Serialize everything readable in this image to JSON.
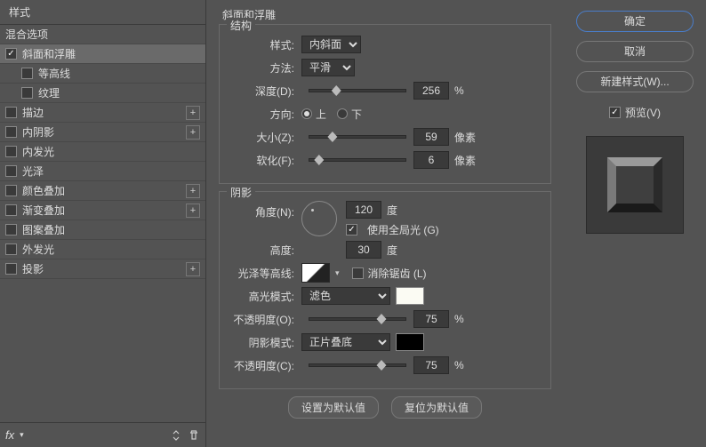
{
  "left": {
    "header": "样式",
    "blend_options": "混合选项",
    "items": [
      {
        "label": "斜面和浮雕",
        "checked": true,
        "selected": true,
        "has_add": false
      },
      {
        "label": "等高线",
        "checked": false,
        "sub": true
      },
      {
        "label": "纹理",
        "checked": false,
        "sub": true
      },
      {
        "label": "描边",
        "checked": false,
        "has_add": true
      },
      {
        "label": "内阴影",
        "checked": false,
        "has_add": true
      },
      {
        "label": "内发光",
        "checked": false
      },
      {
        "label": "光泽",
        "checked": false
      },
      {
        "label": "颜色叠加",
        "checked": false,
        "has_add": true
      },
      {
        "label": "渐变叠加",
        "checked": false,
        "has_add": true
      },
      {
        "label": "图案叠加",
        "checked": false
      },
      {
        "label": "外发光",
        "checked": false
      },
      {
        "label": "投影",
        "checked": false,
        "has_add": true
      }
    ],
    "fx": "fx"
  },
  "mid": {
    "title": "斜面和浮雕",
    "structure": {
      "legend": "结构",
      "style_label": "样式:",
      "style_value": "内斜面",
      "method_label": "方法:",
      "method_value": "平滑",
      "depth_label": "深度(D):",
      "depth_value": "256",
      "depth_unit": "%",
      "direction_label": "方向:",
      "direction_up": "上",
      "direction_down": "下",
      "size_label": "大小(Z):",
      "size_value": "59",
      "size_unit": "像素",
      "soften_label": "软化(F):",
      "soften_value": "6",
      "soften_unit": "像素"
    },
    "shading": {
      "legend": "阴影",
      "angle_label": "角度(N):",
      "angle_value": "120",
      "angle_unit": "度",
      "global_light": "使用全局光 (G)",
      "altitude_label": "高度:",
      "altitude_value": "30",
      "altitude_unit": "度",
      "contour_label": "光泽等高线:",
      "antialias": "消除锯齿 (L)",
      "highlight_mode_label": "高光模式:",
      "highlight_mode_value": "滤色",
      "highlight_opacity_label": "不透明度(O):",
      "highlight_opacity_value": "75",
      "highlight_opacity_unit": "%",
      "shadow_mode_label": "阴影模式:",
      "shadow_mode_value": "正片叠底",
      "shadow_opacity_label": "不透明度(C):",
      "shadow_opacity_value": "75",
      "shadow_opacity_unit": "%"
    },
    "make_default": "设置为默认值",
    "reset_default": "复位为默认值"
  },
  "right": {
    "ok": "确定",
    "cancel": "取消",
    "new_style": "新建样式(W)...",
    "preview": "预览(V)"
  }
}
